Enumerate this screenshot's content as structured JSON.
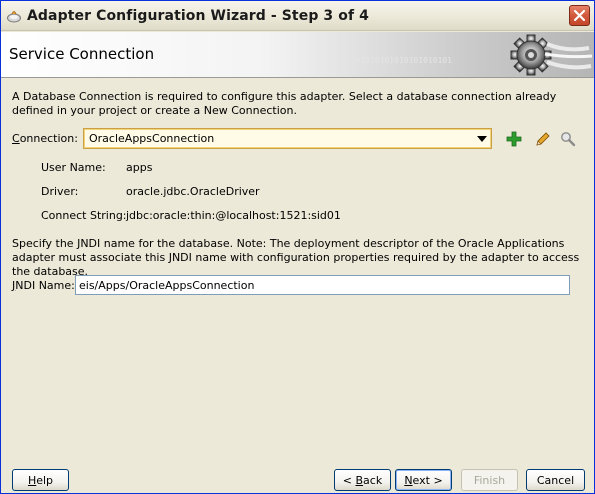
{
  "window": {
    "title": "Adapter Configuration Wizard - Step 3 of 4"
  },
  "header": {
    "title": "Service Connection",
    "watermark": "0101010101010101010101"
  },
  "intro_text": "A Database Connection is required to configure this adapter. Select a database connection already defined in your project or create a New Connection.",
  "connection": {
    "label_prefix": "",
    "label_mnemonic": "C",
    "label_rest": "onnection:",
    "selected": "OracleAppsConnection"
  },
  "info": {
    "user_name_label": "User Name:",
    "user_name_value": "apps",
    "driver_label": "Driver:",
    "driver_value": "oracle.jdbc.OracleDriver",
    "connect_string_label": "Connect String:",
    "connect_string_value": "jdbc:oracle:thin:@localhost:1521:sid01"
  },
  "jndi": {
    "description": "Specify the JNDI name for the database.  Note: The deployment descriptor of the Oracle Applications adapter must associate this JNDI name with configuration properties required by the adapter to access the database.",
    "label_mnemonic": "J",
    "label_rest": "NDI Name:",
    "value": "eis/Apps/OracleAppsConnection"
  },
  "buttons": {
    "help_mnemonic": "H",
    "help_rest": "elp",
    "back_prefix": "< ",
    "back_mnemonic": "B",
    "back_rest": "ack",
    "next_mnemonic": "N",
    "next_rest": "ext >",
    "finish": "Finish",
    "cancel": "Cancel"
  },
  "icons": {
    "app": "oracle-wizard-icon",
    "close": "close-icon",
    "add": "add-icon",
    "edit": "pencil-icon",
    "browse": "magnifier-icon"
  },
  "colors": {
    "add_green": "#2e9b2e",
    "close_red": "#d25a3c",
    "select_border": "#caa042"
  }
}
